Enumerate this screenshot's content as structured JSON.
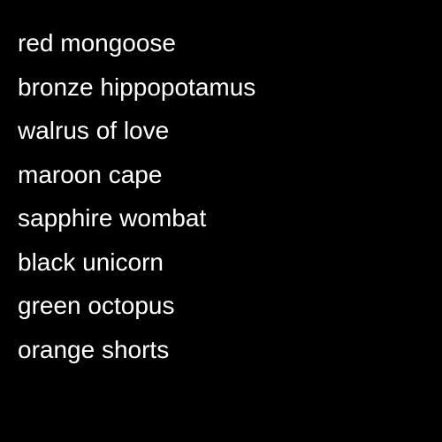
{
  "colors": {
    "background": "#000000",
    "text": "#ffffff"
  },
  "items": [
    "red mongoose",
    "bronze hippopotamus",
    "walrus of love",
    "maroon cape",
    "sapphire wombat",
    "black unicorn",
    "green octopus",
    "orange shorts"
  ]
}
